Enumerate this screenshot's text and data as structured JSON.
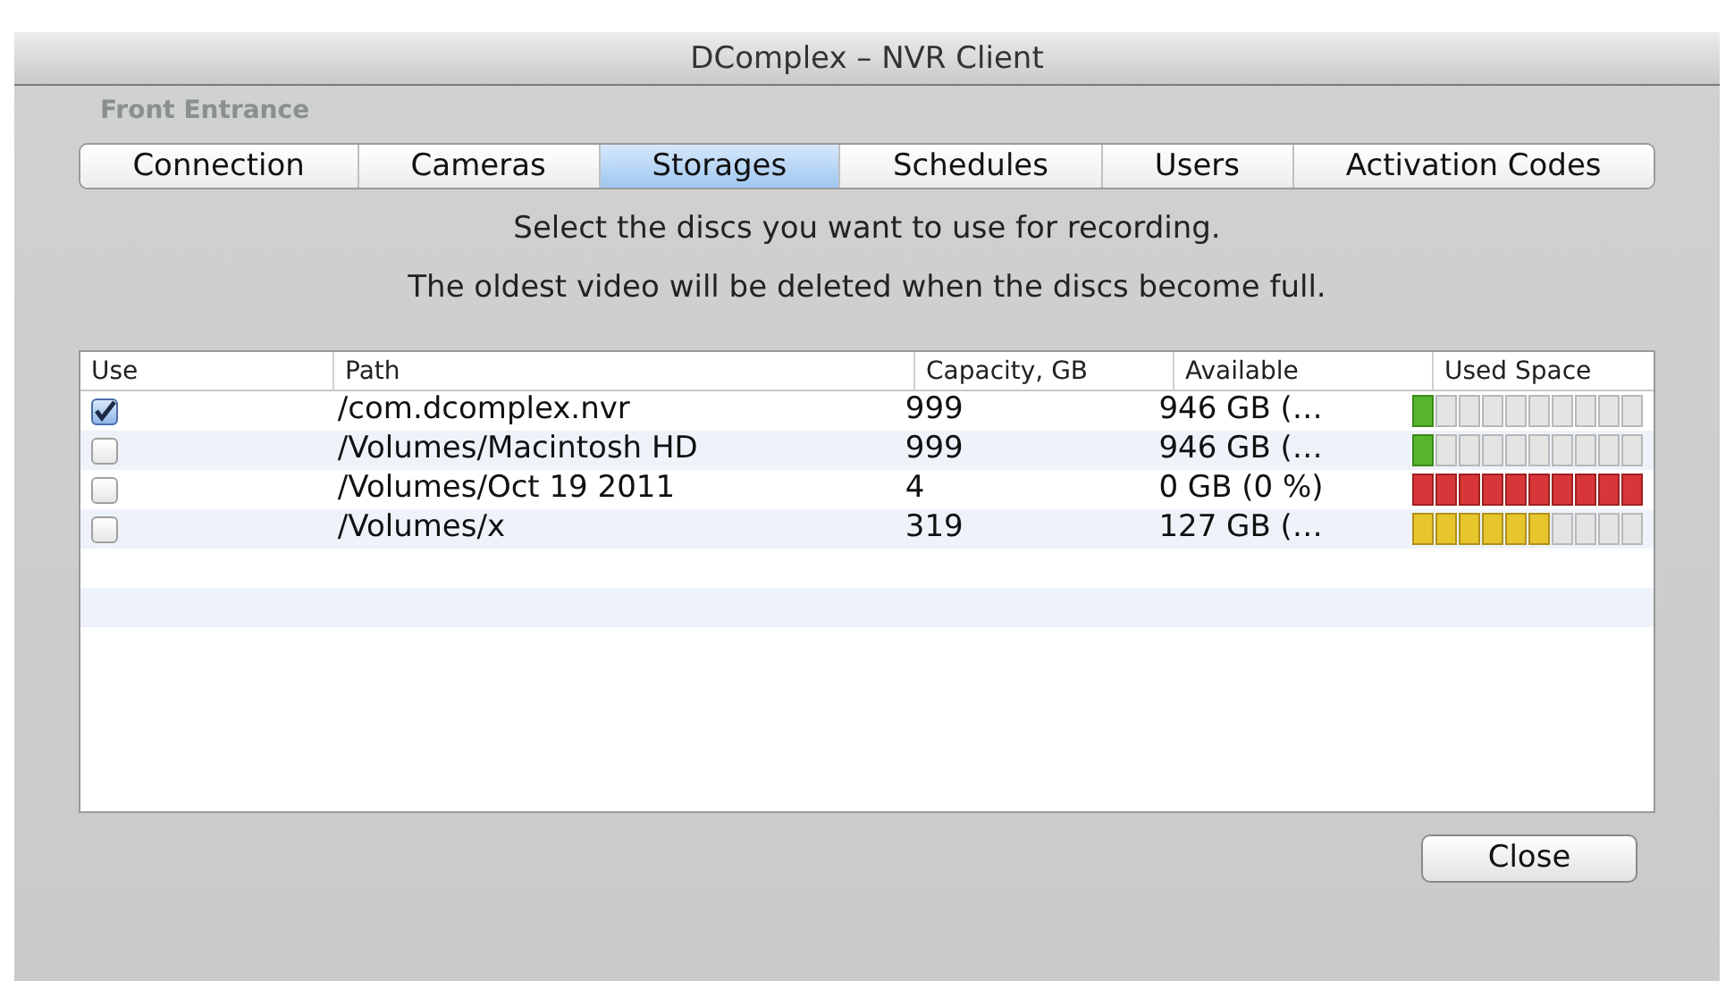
{
  "window": {
    "title": "DComplex – NVR Client"
  },
  "background_label": "Front Entrance",
  "tabs": [
    {
      "label": "Connection",
      "selected": false
    },
    {
      "label": "Cameras",
      "selected": false
    },
    {
      "label": "Storages",
      "selected": true
    },
    {
      "label": "Schedules",
      "selected": false
    },
    {
      "label": "Users",
      "selected": false
    },
    {
      "label": "Activation Codes",
      "selected": false
    }
  ],
  "instructions": [
    "Select the discs you want to use for recording.",
    "The oldest video will be deleted when the discs become full."
  ],
  "table": {
    "columns": [
      "Use",
      "Path",
      "Capacity, GB",
      "Available",
      "Used Space"
    ],
    "rows": [
      {
        "checked": true,
        "path": "/com.dcomplex.nvr",
        "capacity": "999",
        "available": "946 GB (…",
        "level": 0.1
      },
      {
        "checked": false,
        "path": "/Volumes/Macintosh HD",
        "capacity": "999",
        "available": "946 GB (…",
        "level": 0.1
      },
      {
        "checked": false,
        "path": "/Volumes/Oct 19 2011",
        "capacity": "4",
        "available": "0 GB (0 %)",
        "level": 1
      },
      {
        "checked": false,
        "path": "/Volumes/x",
        "capacity": "319",
        "available": "127 GB (…",
        "level": 0.6
      }
    ]
  },
  "buttons": [
    "Close"
  ]
}
